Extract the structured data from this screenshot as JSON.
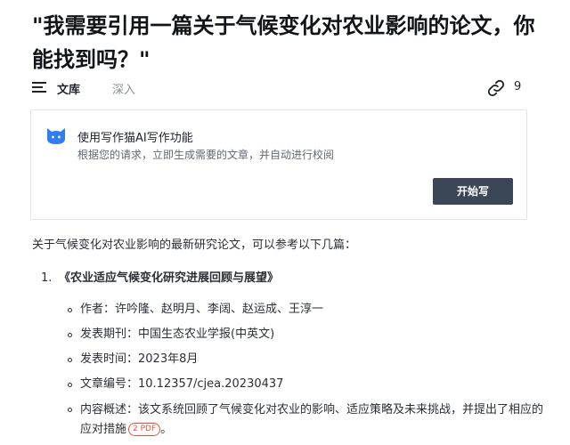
{
  "title": "\"我需要引用一篇关于气候变化对农业影响的论文，你能找到吗？\"",
  "tabs": {
    "active_label": "文库",
    "inactive_label": "深入",
    "link_count": "9"
  },
  "promo_card": {
    "title": "使用写作猫AI写作功能",
    "subtitle": "根据您的请求，立即生成需要的文章，并自动进行校阅",
    "button_label": "开始写",
    "icon": "cat-icon",
    "icon_color": "#2f7df6"
  },
  "intro": "关于气候变化对农业影响的最新研究论文，可以参考以下几篇：",
  "papers": [
    {
      "number": "1.",
      "title": "《农业适应气候变化研究进展回顾与展望》",
      "details": [
        "作者：许吟隆、赵明月、李阔、赵运成、王淳一",
        "发表期刊：中国生态农业学报(中英文)",
        "发表时间：2023年8月",
        "文章编号：10.12357/cjea.20230437",
        "内容概述：该文系统回顾了气候变化对农业的影响、适应策略及未来挑战，并提出了相应的应对措施"
      ],
      "pdf_badge": "2 PDF"
    }
  ],
  "colors": {
    "button_bg": "#3b4657",
    "badge_red": "#e0533f"
  }
}
